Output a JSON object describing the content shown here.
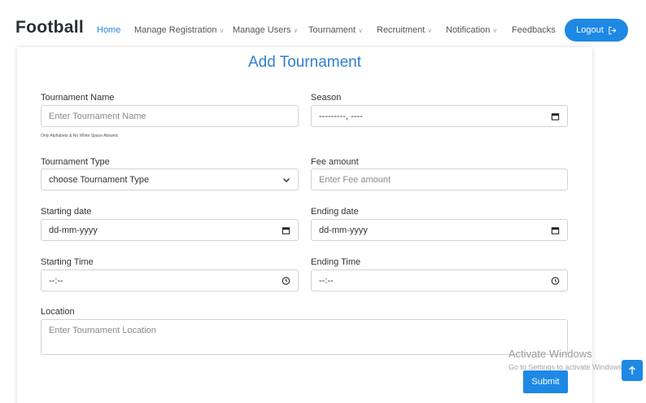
{
  "brand": "Football",
  "nav": {
    "home": "Home",
    "manage_registration": "Manage Registration",
    "manage_users": "Manage Users",
    "tournament": "Tournament",
    "recruitment": "Recruitment",
    "notification": "Notification",
    "feedbacks": "Feedbacks",
    "logout": "Logout"
  },
  "form": {
    "title": "Add Tournament",
    "tournament_name": {
      "label": "Tournament Name",
      "placeholder": "Enter Tournament Name",
      "hint": "Only Alphabets & No White Space Allowed."
    },
    "season": {
      "label": "Season",
      "value": "---------, ----"
    },
    "tournament_type": {
      "label": "Tournament Type",
      "value": "choose Tournament Type"
    },
    "fee_amount": {
      "label": "Fee amount",
      "placeholder": "Enter Fee amount"
    },
    "starting_date": {
      "label": "Starting date",
      "value": "dd-mm-yyyy"
    },
    "ending_date": {
      "label": "Ending date",
      "value": "dd-mm-yyyy"
    },
    "starting_time": {
      "label": "Starting Time",
      "value": "--:--"
    },
    "ending_time": {
      "label": "Ending Time",
      "value": "--:--"
    },
    "location": {
      "label": "Location",
      "placeholder": "Enter Tournament Location"
    },
    "submit": "Submit"
  },
  "watermark": {
    "line1": "Activate Windows",
    "line2": "Go to Settings to activate Windows."
  },
  "colors": {
    "accent": "#1e88e5",
    "title": "#2f80d1"
  }
}
